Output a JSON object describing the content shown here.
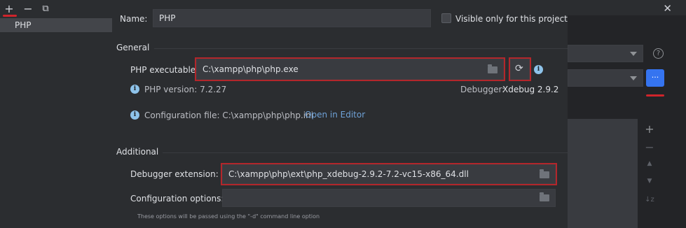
{
  "left_panel": {
    "toolbar": {
      "add_label": "+",
      "remove_label": "−",
      "copy_label": "⧉"
    },
    "items": [
      {
        "label": "PHP"
      }
    ]
  },
  "main": {
    "name_label": "Name:",
    "name_value": "PHP",
    "visible_only_label": "Visible only for this project",
    "general_section": "General",
    "php_executable_label": "PHP executable:",
    "php_executable_value": "C:\\xampp\\php\\php.exe",
    "php_version_text": "PHP version: 7.2.27",
    "debugger_label": "Debugger:",
    "debugger_value": "Xdebug 2.9.2",
    "config_file_text": "Configuration file: C:\\xampp\\php\\php.ini",
    "open_in_editor_label": "Open in Editor",
    "additional_section": "Additional",
    "debugger_extension_label": "Debugger extension:",
    "debugger_extension_value": "C:\\xampp\\php\\ext\\php_xdebug-2.9.2-7.2-vc15-x86_64.dll",
    "config_options_label": "Configuration options:",
    "config_options_value": "",
    "config_options_hint": "These options will be passed using the \"-d\" command line option"
  },
  "right_panel": {
    "close_label": "✕",
    "help_label": "?",
    "ellipsis_label": "...",
    "tools": {
      "add": "+",
      "remove": "−",
      "up": "▲",
      "down": "▼",
      "sort": "↓z"
    }
  },
  "colors": {
    "highlight": "#b3262b",
    "accent": "#3574f0",
    "link": "#6fa2d8",
    "info": "#8ec3ea"
  }
}
